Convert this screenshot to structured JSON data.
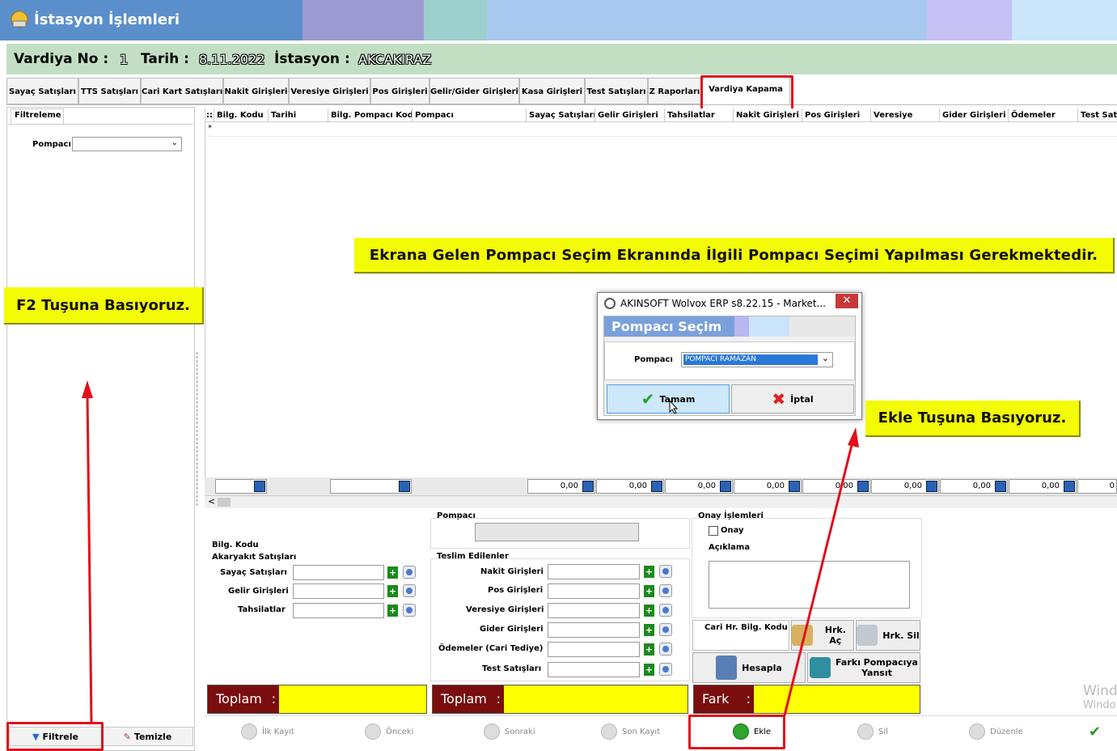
{
  "window": {
    "title": "İstasyon İşlemleri"
  },
  "header": {
    "vardiya_label": "Vardiya No :",
    "vardiya_value": "1",
    "tarih_label": "Tarih :",
    "tarih_value": "8.11.2022",
    "istasyon_label": "İstasyon :",
    "istasyon_value": "AKCAKIRAZ"
  },
  "tabs": [
    "Sayaç Satışları",
    "TTS Satışları",
    "Cari Kart Satışları",
    "Nakit Girişleri",
    "Veresiye Girişleri",
    "Pos Girişleri",
    "Gelir/Gider Girişleri",
    "Kasa Girişleri",
    "Test Satışları",
    "Z Raporları",
    "Vardiya Kapama"
  ],
  "filter": {
    "tab": "Filtreleme",
    "pompaci_label": "Pompacı",
    "pompaci_value": "",
    "filter_button": "Filtrele",
    "clear_button": "Temizle"
  },
  "grid": {
    "columns": [
      "Bilg. Kodu",
      "Tarihi",
      "Bilg. Pompacı Kodu",
      "Pompacı",
      "Sayaç Satışları",
      "Gelir Girişleri",
      "Tahsilatlar",
      "Nakit Girişleri",
      "Pos Girişleri",
      "Veresiye",
      "Gider Girişleri",
      "Ödemeler",
      "Test Satı"
    ],
    "new_row_marker": "*",
    "sums": [
      "0,00",
      "0,00",
      "0,00",
      "0,00",
      "0,00",
      "0,00",
      "0,00",
      "0,00",
      "0"
    ]
  },
  "form": {
    "bilg_kodu": "Bilg. Kodu",
    "akaryakit": "Akaryakıt Satışları",
    "left_fields": [
      "Sayaç Satışları",
      "Gelir Girişleri",
      "Tahsilatlar"
    ],
    "pompaci": "Pompacı",
    "teslim": "Teslim Edilenler",
    "mid_fields": [
      "Nakit Girişleri",
      "Pos Girişleri",
      "Veresiye Girişleri",
      "Gider Girişleri",
      "Ödemeler (Cari Tediye)",
      "Test Satışları"
    ],
    "onay_group": "Onay İşlemleri",
    "onay": "Onay",
    "aciklama": "Açıklama",
    "cari_hr": "Cari Hr. Bilg. Kodu",
    "hrk_ac": "Hrk. Aç",
    "hrk_sil": "Hrk. Sil",
    "hesapla": "Hesapla",
    "farki_1": "Farkı Pompacıya",
    "farki_2": "Yansıt",
    "toplam1": "Toplam",
    "toplam2": "Toplam",
    "fark": "Fark",
    "colon": ":"
  },
  "nav": {
    "first": "İlk Kayıt",
    "prev": "Önceki",
    "next": "Sonraki",
    "last": "Son Kayıt",
    "add": "Ekle",
    "delete": "Sil",
    "edit": "Düzenle"
  },
  "dialog": {
    "title": "AKINSOFT Wolvox ERP s8.22.15 - Market...",
    "header": "Pompacı Seçim",
    "pompaci_label": "Pompacı",
    "pompaci_value": "POMPACI RAMAZAN",
    "ok": "Tamam",
    "cancel": "İptal"
  },
  "callouts": {
    "top": "Ekrana Gelen Pompacı Seçim Ekranında İlgili Pompacı Seçimi Yapılması Gerekmektedir.",
    "f2": "F2 Tuşuna Basıyoruz.",
    "ekle": "Ekle Tuşuna Basıyoruz."
  },
  "watermark": {
    "line1": "Wind",
    "line2": "Windo"
  },
  "colors": {
    "title_bg": "#5b8fcb",
    "info_bg": "#c2dfc4",
    "callout": "#f3fb05",
    "highlight": "#e1101a",
    "total_bg": "#ffff00",
    "total_label": "#7a0d0d"
  }
}
